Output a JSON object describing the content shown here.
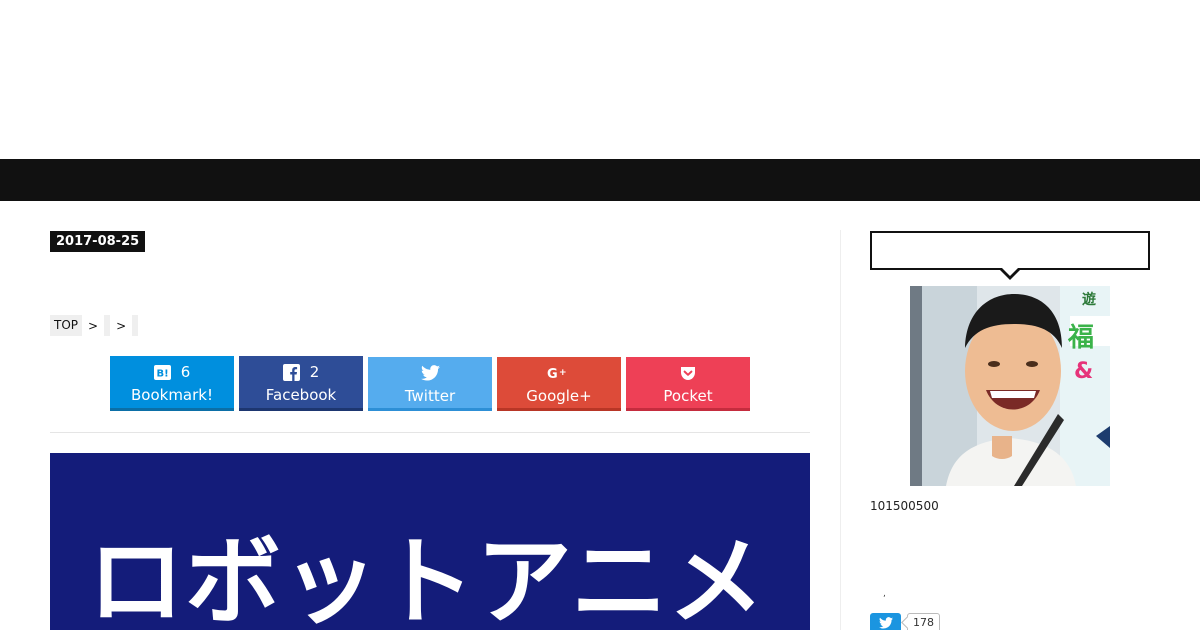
{
  "article": {
    "date": "2017-08-25",
    "hero_text": "ロボットアニメ"
  },
  "breadcrumb": {
    "top": "TOP",
    "sep1": ">",
    "sep2": ">"
  },
  "share": {
    "hatena": {
      "count": "6",
      "label": "Bookmark!",
      "icon": "hatena-bookmark-icon"
    },
    "facebook": {
      "count": "2",
      "label": "Facebook",
      "icon": "facebook-icon"
    },
    "twitter": {
      "label": "Twitter",
      "icon": "twitter-bird-icon"
    },
    "google": {
      "label": "Google+",
      "icon": "google-plus-icon"
    },
    "pocket": {
      "label": "Pocket",
      "icon": "pocket-icon"
    }
  },
  "colors": {
    "nav_bar": "#111111",
    "hatena": "#008fde",
    "facebook": "#2e4d97",
    "twitter": "#55acee",
    "google": "#dd4b39",
    "pocket": "#ee4056",
    "hero_bg": "#141c7a"
  },
  "sidebar": {
    "profile_numbers": "101500500",
    "tiny_mark": ",",
    "tweet_count": "178"
  }
}
